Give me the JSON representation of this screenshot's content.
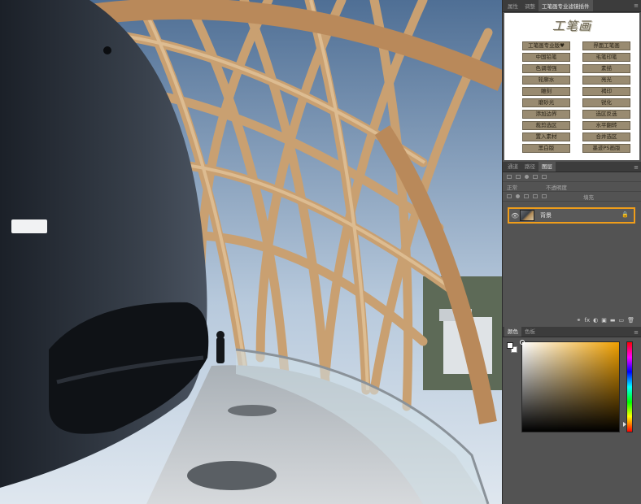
{
  "panels": {
    "top_tabs": [
      "属性",
      "调整",
      "工笔画专业滤镜插件"
    ],
    "plugin": {
      "logo": "工笔画",
      "buttons": [
        "工笔画专业版♥",
        "界面工笔画",
        "中国铅笔",
        "毛笔印笔",
        "色调增强",
        "素描",
        "轮廓水",
        "亮光",
        "雕刻",
        "褐印",
        "磨砂光",
        "锐化",
        "添加边界",
        "选区反选",
        "裁剪选区",
        "水平翻转",
        "置入素材",
        "合并选区",
        "黑白版",
        "墨迹PS画版"
      ]
    },
    "layers_tabs": [
      "通道",
      "路径",
      "图层"
    ],
    "layers_toolbar": {
      "kind_label": "正常",
      "opacity_label": "不透明度",
      "fill_label": "填充"
    },
    "layer": {
      "name": "背景",
      "eye": "👁",
      "lock": "🔒"
    },
    "layer_footer_icons": [
      "⚭",
      "fx",
      "◐",
      "▣",
      "▬",
      "▭",
      "🗑"
    ],
    "color_tabs": [
      "颜色",
      "色板"
    ]
  },
  "colors": {
    "panel_bg": "#535353",
    "highlight": "#ef9d1a",
    "plugin_button": "#998b71",
    "picker_hue": "#f0a000"
  }
}
